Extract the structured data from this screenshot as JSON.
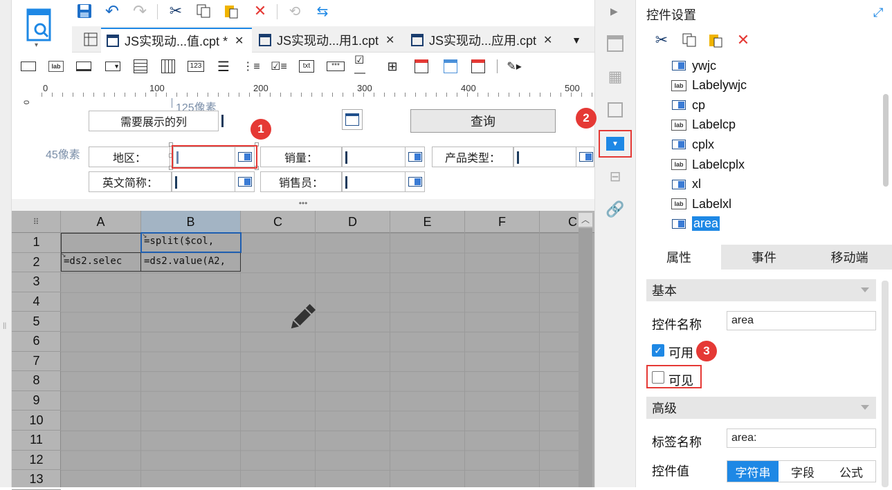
{
  "tabs": [
    {
      "label": "JS实现动...值.cpt *"
    },
    {
      "label": "JS实现动...用1.cpt"
    },
    {
      "label": "JS实现动...应用.cpt"
    }
  ],
  "ruler": {
    "marks": [
      "0",
      "100",
      "200",
      "300",
      "400",
      "500"
    ]
  },
  "form": {
    "annot_125": "125像素",
    "annot_45": "45像素",
    "label_columns": "需要展示的列",
    "query_button": "查询",
    "label_area": "地区：",
    "label_sales": "销量：",
    "label_product_type": "产品类型：",
    "label_en_abbr": "英文简称：",
    "label_salesperson": "销售员："
  },
  "grid": {
    "columns": [
      "A",
      "B",
      "C",
      "D",
      "E",
      "F",
      "C"
    ],
    "rows": [
      "1",
      "2",
      "3",
      "4",
      "5",
      "6",
      "7",
      "8",
      "9",
      "10",
      "11",
      "12",
      "13"
    ],
    "cells": {
      "B1": "=split($col,",
      "A2": "=ds2.selec",
      "B2": "=ds2.value(A2,"
    }
  },
  "badges": [
    "1",
    "2",
    "3"
  ],
  "panel": {
    "title": "控件设置",
    "tree": [
      {
        "name": "ywjc",
        "icon": "combo-icon"
      },
      {
        "name": "Labelywjc",
        "icon": "label-icon"
      },
      {
        "name": "cp",
        "icon": "combo-icon"
      },
      {
        "name": "Labelcp",
        "icon": "label-icon"
      },
      {
        "name": "cplx",
        "icon": "combo-icon"
      },
      {
        "name": "Labelcplx",
        "icon": "label-icon"
      },
      {
        "name": "xl",
        "icon": "combo-icon"
      },
      {
        "name": "Labelxl",
        "icon": "label-icon"
      },
      {
        "name": "area",
        "icon": "combo-icon",
        "selected": true
      }
    ],
    "tabs": [
      "属性",
      "事件",
      "移动端"
    ],
    "basic_section": "基本",
    "name_label": "控件名称",
    "name_value": "area",
    "enabled_label": "可用",
    "visible_label": "可见",
    "advanced_section": "高级",
    "tag_label": "标签名称",
    "tag_value": "area:",
    "value_label": "控件值",
    "value_options": [
      "字符串",
      "字段",
      "公式"
    ],
    "value_selected": "字符串"
  },
  "colors": {
    "accent": "#1e88e5",
    "red": "#e53935",
    "grid_bg": "#a9a9a9"
  }
}
